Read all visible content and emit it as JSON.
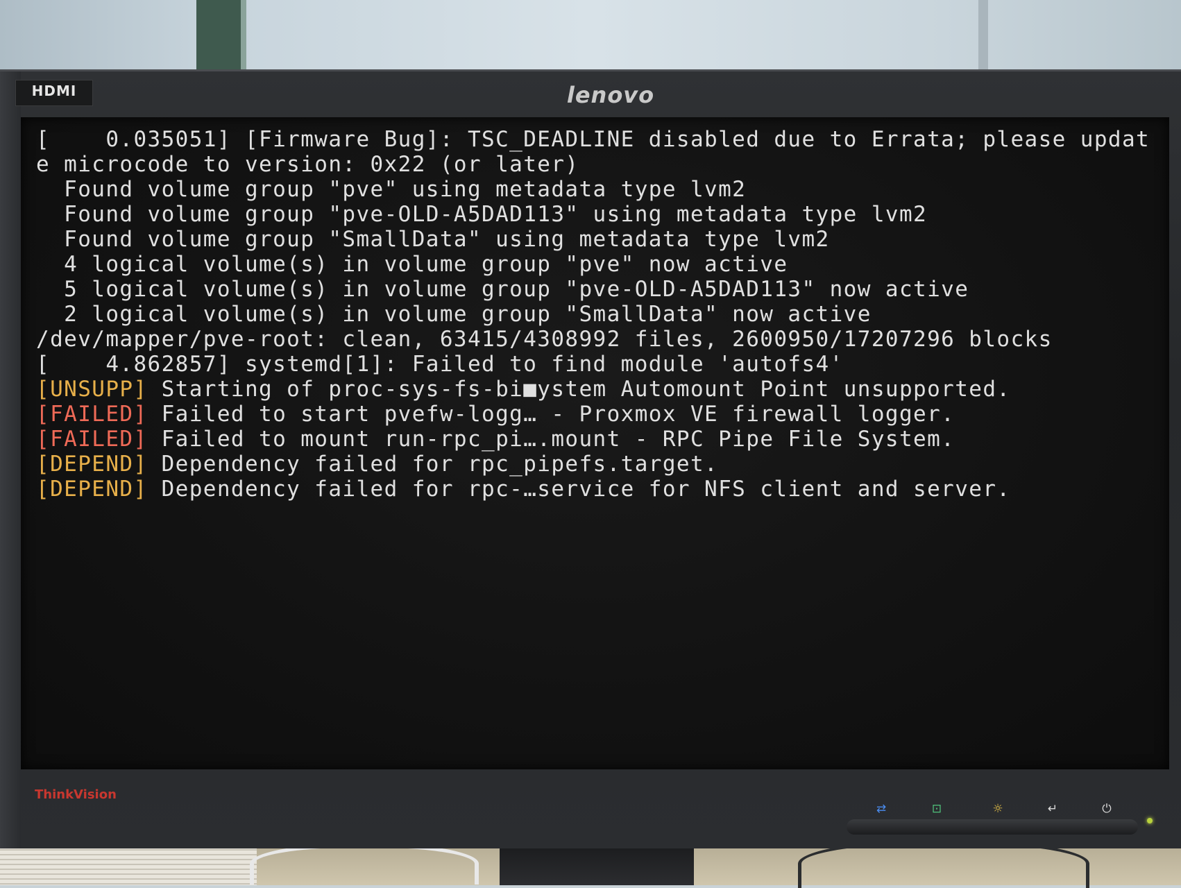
{
  "monitor": {
    "brand": "lenovo",
    "model_brand": "ThinkVision",
    "hdmi_logo": "HDMI",
    "controls": [
      {
        "icon": "input-select-icon",
        "glyph": "⇄"
      },
      {
        "icon": "auto-adjust-icon",
        "glyph": "⊡"
      },
      {
        "icon": "brightness-icon",
        "glyph": "☼"
      },
      {
        "icon": "enter-icon",
        "glyph": "↵"
      },
      {
        "icon": "power-icon",
        "glyph": "⏻"
      }
    ],
    "colors": {
      "tag_unsupp": "#e8b04a",
      "tag_failed": "#ef6a57",
      "tag_depend": "#e8b04a",
      "console_text": "#e0e0e0",
      "brand_red": "#c8372f"
    }
  },
  "console": {
    "lines": [
      {
        "text": "[    0.035051] [Firmware Bug]: TSC_DEADLINE disabled due to Errata; please updat"
      },
      {
        "text": "e microcode to version: 0x22 (or later)"
      },
      {
        "text": "  Found volume group \"pve\" using metadata type lvm2"
      },
      {
        "text": "  Found volume group \"pve-OLD-A5DAD113\" using metadata type lvm2"
      },
      {
        "text": "  Found volume group \"SmallData\" using metadata type lvm2"
      },
      {
        "text": "  4 logical volume(s) in volume group \"pve\" now active"
      },
      {
        "text": "  5 logical volume(s) in volume group \"pve-OLD-A5DAD113\" now active"
      },
      {
        "text": "  2 logical volume(s) in volume group \"SmallData\" now active"
      },
      {
        "text": "/dev/mapper/pve-root: clean, 63415/4308992 files, 2600950/17207296 blocks"
      },
      {
        "text": "[    4.862857] systemd[1]: Failed to find module 'autofs4'"
      },
      {
        "tag": "UNSUPP",
        "text": " Starting of proc-sys-fs-bi■ystem Automount Point unsupported."
      },
      {
        "tag": "FAILED",
        "text": " Failed to start pvefw-logg… - Proxmox VE firewall logger."
      },
      {
        "tag": "FAILED",
        "text": " Failed to mount run-rpc_pi….mount - RPC Pipe File System."
      },
      {
        "tag": "DEPEND",
        "text": " Dependency failed for rpc_pipefs.target."
      },
      {
        "tag": "DEPEND",
        "text": " Dependency failed for rpc-…service for NFS client and server."
      }
    ]
  }
}
